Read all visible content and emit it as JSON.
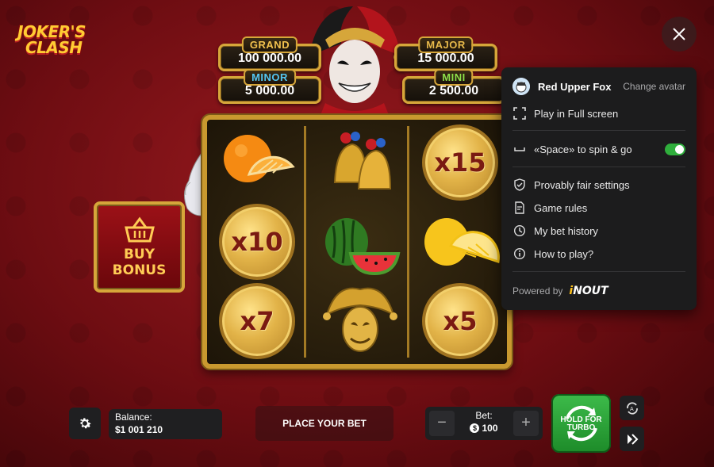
{
  "logo": {
    "line1": "JOKER'S",
    "line2": "CLASH"
  },
  "jackpots": [
    {
      "name": "GRAND",
      "value": "100 000.00",
      "color": "#f2c14e"
    },
    {
      "name": "MAJOR",
      "value": "15 000.00",
      "color": "#e7b94a"
    },
    {
      "name": "MINOR",
      "value": "5 000.00",
      "color": "#54c6f2"
    },
    {
      "name": "MINI",
      "value": "2 500.00",
      "color": "#8ee04a"
    }
  ],
  "reels": {
    "symbols": [
      [
        "orange-icon",
        "bells-icon",
        "multiplier-coin"
      ],
      [
        "multiplier-coin",
        "watermelon-icon",
        "lemon-icon"
      ],
      [
        "multiplier-coin",
        "golden-jester-icon",
        "multiplier-coin"
      ]
    ],
    "multipliers": {
      "r0c2": "x15",
      "r1c0": "x10",
      "r2c0": "x7",
      "r2c2": "x5"
    }
  },
  "buy_bonus": {
    "line1": "BUY",
    "line2": "BONUS"
  },
  "bottom": {
    "balance_label": "Balance:",
    "balance_value": "$1 001 210",
    "place_bet": "PLACE YOUR BET",
    "bet_label": "Bet:",
    "bet_value": "100",
    "currency_symbol": "$",
    "minus": "−",
    "plus": "+",
    "turbo_line1": "HOLD FOR",
    "turbo_line2": "TURBO"
  },
  "menu": {
    "username": "Red Upper Fox",
    "change_avatar": "Change avatar",
    "fullscreen": "Play in Full screen",
    "space_spin": "«Space» to spin & go",
    "space_spin_enabled": true,
    "provably_fair": "Provably fair settings",
    "game_rules": "Game rules",
    "bet_history": "My bet history",
    "how_to_play": "How to play?",
    "powered_by": "Powered by",
    "brand_i": "i",
    "brand_rest": "NOUT"
  },
  "colors": {
    "accent_green": "#2fae3c",
    "gold": "#d6a63a",
    "panel": "#1c1c1d"
  }
}
